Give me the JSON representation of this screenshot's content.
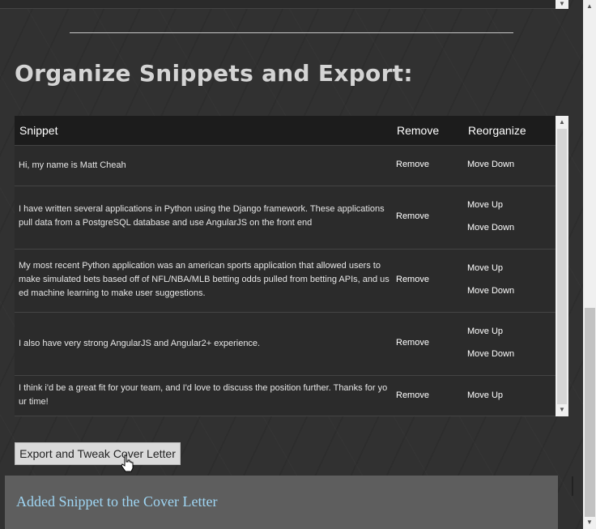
{
  "page": {
    "heading": "Organize Snippets and Export:"
  },
  "table": {
    "headers": {
      "snippet": "Snippet",
      "remove": "Remove",
      "reorganize": "Reorganize"
    },
    "rows": [
      {
        "text": "Hi, my name is Matt Cheah",
        "remove": "Remove",
        "move_down": "Move Down"
      },
      {
        "text": "I have written several applications in Python using the Django framework. These applications pull data from a PostgreSQL database and use AngularJS on the front end",
        "remove": "Remove",
        "move_up": "Move Up",
        "move_down": "Move Down"
      },
      {
        "text": "My most recent Python application was an american sports application that allowed users to make simulated bets based off of NFL/NBA/MLB betting odds pulled from betting APIs, and used machine learning to make user suggestions.",
        "remove": "Remove",
        "move_up": "Move Up",
        "move_down": "Move Down"
      },
      {
        "text": "I also have very strong AngularJS and Angular2+ experience.",
        "remove": "Remove",
        "move_up": "Move Up",
        "move_down": "Move Down"
      },
      {
        "text": "I think i'd be a great fit for your team, and I'd love to discuss the position further. Thanks for your time!",
        "remove": "Remove",
        "move_up": "Move Up"
      }
    ]
  },
  "export_button": {
    "label": "Export and Tweak Cover Letter"
  },
  "notice": {
    "text": "Added Snippet to the Cover Letter",
    "color": "#9fd6f4"
  },
  "icons": {
    "scroll_up": "chevron-up-icon",
    "scroll_down": "chevron-down-icon",
    "cursor": "hand-pointer-icon"
  }
}
